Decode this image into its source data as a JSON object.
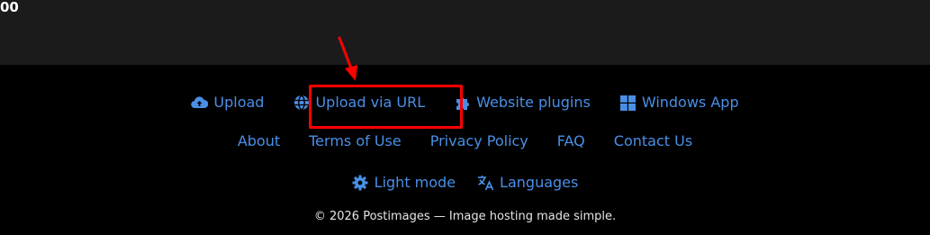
{
  "top": {
    "fragment": "00"
  },
  "footer": {
    "primary_links": [
      {
        "label": "Upload",
        "icon": "cloud-upload-icon"
      },
      {
        "label": "Upload via URL",
        "icon": "globe-icon"
      },
      {
        "label": "Website plugins",
        "icon": "puzzle-icon"
      },
      {
        "label": "Windows App",
        "icon": "windows-icon"
      }
    ],
    "secondary_links": [
      {
        "label": "About"
      },
      {
        "label": "Terms of Use"
      },
      {
        "label": "Privacy Policy"
      },
      {
        "label": "FAQ"
      },
      {
        "label": "Contact Us"
      }
    ],
    "settings_links": [
      {
        "label": "Light mode",
        "icon": "gear-icon"
      },
      {
        "label": "Languages",
        "icon": "translate-icon"
      }
    ],
    "copyright": "© 2026 Postimages — Image hosting made simple."
  },
  "annotation": {
    "highlight_color": "#ff0000",
    "arrow_color": "#ff0000",
    "highlighted_item": "Upload via URL"
  },
  "colors": {
    "link": "#4a8fe6",
    "top_strip_bg": "#1b1b1b",
    "footer_bg": "#000000"
  }
}
